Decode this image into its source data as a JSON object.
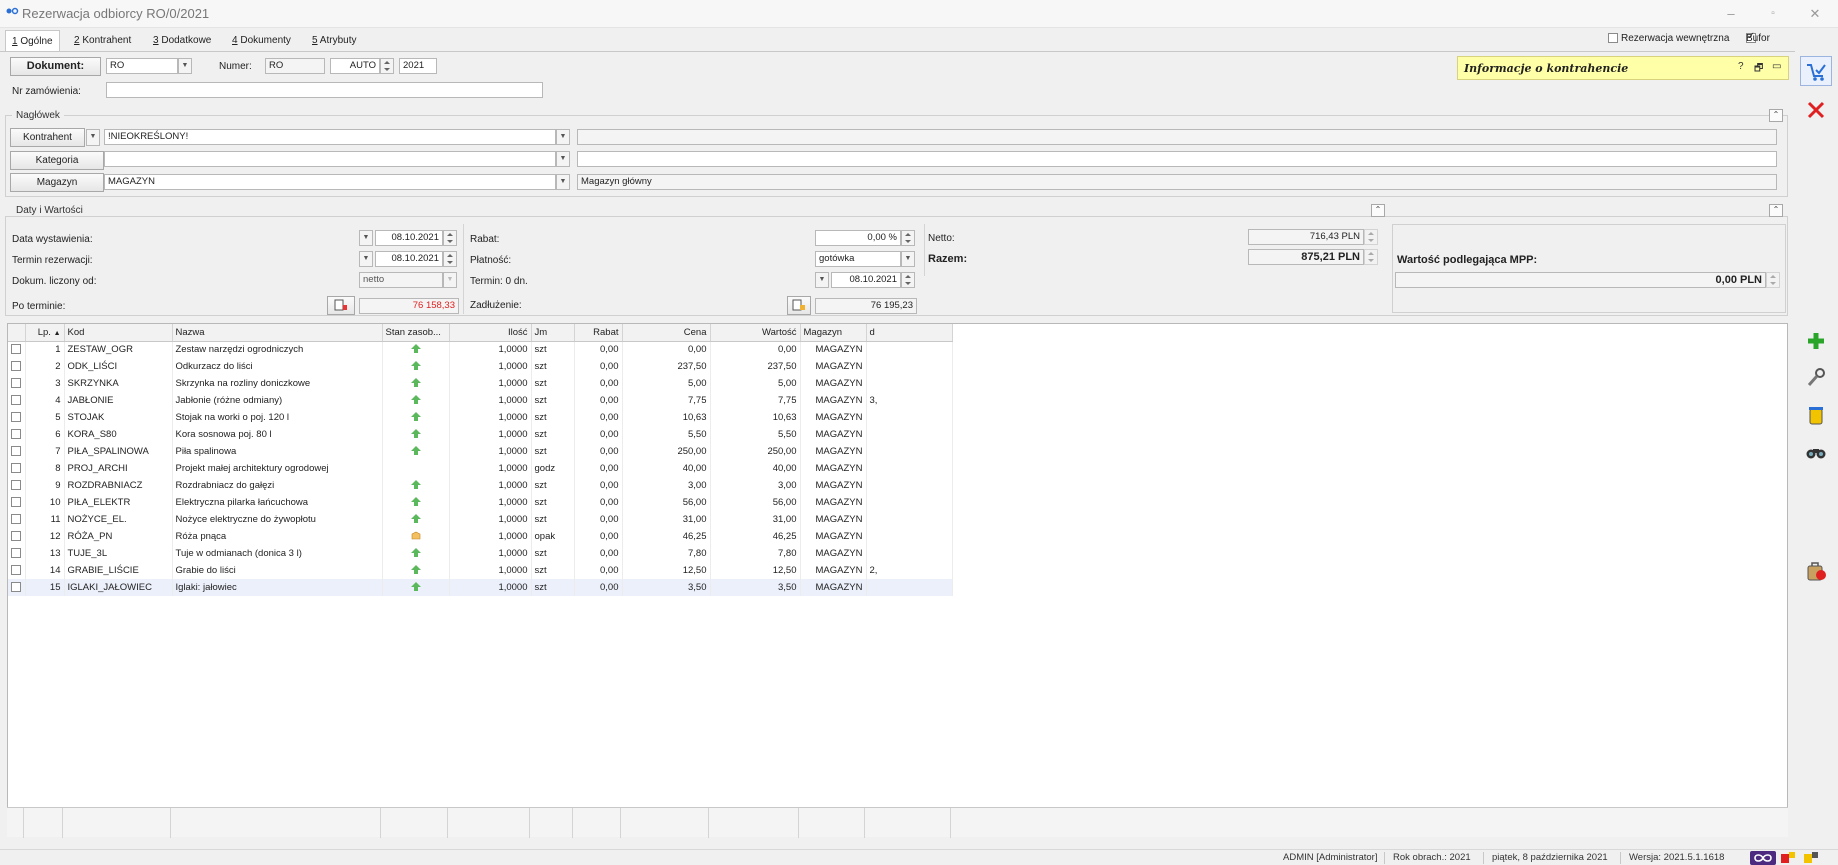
{
  "window": {
    "title": "Rezerwacja odbiorcy RO/0/2021"
  },
  "tabs": [
    {
      "key": "1",
      "label": " Ogólne"
    },
    {
      "key": "2",
      "label": " Kontrahent"
    },
    {
      "key": "3",
      "label": " Dodatkowe"
    },
    {
      "key": "4",
      "label": " Dokumenty"
    },
    {
      "key": "5",
      "label": " Atrybuty"
    }
  ],
  "top_options": {
    "internal_label": "Rezerwacja wewnętrzna",
    "buffer_label": "Bufor"
  },
  "document": {
    "doc_label": "Dokument:",
    "doc_value": "RO",
    "number_label": "Numer:",
    "number_prefix": "RO",
    "number_auto": "AUTO",
    "number_year": "2021",
    "order_label": "Nr zamówienia:",
    "order_value": ""
  },
  "info": {
    "title": "Informacje o kontrahencie",
    "help": "?"
  },
  "header": {
    "title": "Nagłówek",
    "kontrahent_btn": "Kontrahent",
    "kontrahent_value": "!NIEOKREŚLONY!",
    "kontrahent_desc": "",
    "kategoria_btn": "Kategoria",
    "kategoria_value": "",
    "kategoria_desc": "",
    "magazyn_btn": "Magazyn",
    "magazyn_value": "MAGAZYN",
    "magazyn_desc": "Magazyn główny"
  },
  "dates": {
    "title": "Daty i Wartości",
    "issue_label": "Data wystawienia:",
    "issue_value": "08.10.2021",
    "reserve_label": "Termin rezerwacji:",
    "reserve_value": "08.10.2021",
    "calc_label": "Dokum. liczony od:",
    "calc_value": "netto",
    "overdue_label": "Po terminie:",
    "overdue_value": "76 158,33",
    "discount_label": "Rabat:",
    "discount_value": "0,00 %",
    "payment_label": "Płatność:",
    "payment_value": "gotówka",
    "term_label": "Termin: 0 dn.",
    "term_value": "08.10.2021",
    "debt_label": "Zadłużenie:",
    "debt_value": "76 195,23",
    "net_label": "Netto:",
    "net_value": "716,43 PLN",
    "total_label": "Razem:",
    "total_value": "875,21 PLN",
    "mpp_label": "Wartość podlegająca MPP:",
    "mpp_value": "0,00 PLN"
  },
  "table": {
    "headers": [
      "",
      "Lp.",
      "Kod",
      "Nazwa",
      "Stan zasob...",
      "Ilość",
      "Jm",
      "Rabat",
      "Cena",
      "Wartość",
      "Magazyn",
      "d"
    ],
    "sort_icon": "▲",
    "rows": [
      [
        "1",
        "ZESTAW_OGR",
        "Zestaw narzędzi ogrodniczych",
        "up",
        "1,0000",
        "szt",
        "0,00",
        "0,00",
        "0,00",
        "MAGAZYN",
        ""
      ],
      [
        "2",
        "ODK_LIŚCI",
        "Odkurzacz do liści",
        "up",
        "1,0000",
        "szt",
        "0,00",
        "237,50",
        "237,50",
        "MAGAZYN",
        ""
      ],
      [
        "3",
        "SKRZYNKA",
        "Skrzynka na rozliny doniczkowe",
        "up",
        "1,0000",
        "szt",
        "0,00",
        "5,00",
        "5,00",
        "MAGAZYN",
        ""
      ],
      [
        "4",
        "JABŁONIE",
        "Jabłonie (różne odmiany)",
        "up",
        "1,0000",
        "szt",
        "0,00",
        "7,75",
        "7,75",
        "MAGAZYN",
        "3,"
      ],
      [
        "5",
        "STOJAK",
        "Stojak na worki o poj. 120 l",
        "up",
        "1,0000",
        "szt",
        "0,00",
        "10,63",
        "10,63",
        "MAGAZYN",
        ""
      ],
      [
        "6",
        "KORA_S80",
        "Kora sosnowa poj. 80 l",
        "up",
        "1,0000",
        "szt",
        "0,00",
        "5,50",
        "5,50",
        "MAGAZYN",
        ""
      ],
      [
        "7",
        "PIŁA_SPALINOWA",
        "Piła spalinowa",
        "up",
        "1,0000",
        "szt",
        "0,00",
        "250,00",
        "250,00",
        "MAGAZYN",
        ""
      ],
      [
        "8",
        "PROJ_ARCHI",
        "Projekt małej architektury ogrodowej",
        "",
        "1,0000",
        "godz",
        "0,00",
        "40,00",
        "40,00",
        "MAGAZYN",
        ""
      ],
      [
        "9",
        "ROZDRABNIACZ",
        "Rozdrabniacz do gałęzi",
        "up",
        "1,0000",
        "szt",
        "0,00",
        "3,00",
        "3,00",
        "MAGAZYN",
        ""
      ],
      [
        "10",
        "PIŁA_ELEKTR",
        "Elektryczna pilarka łańcuchowa",
        "up",
        "1,0000",
        "szt",
        "0,00",
        "56,00",
        "56,00",
        "MAGAZYN",
        ""
      ],
      [
        "11",
        "NOŻYCE_EL.",
        "Nożyce elektryczne do żywopłotu",
        "up",
        "1,0000",
        "szt",
        "0,00",
        "31,00",
        "31,00",
        "MAGAZYN",
        ""
      ],
      [
        "12",
        "RÓŻA_PN",
        "Róża pnąca",
        "box",
        "1,0000",
        "opak",
        "0,00",
        "46,25",
        "46,25",
        "MAGAZYN",
        ""
      ],
      [
        "13",
        "TUJE_3L",
        "Tuje w odmianach (donica 3 l)",
        "up",
        "1,0000",
        "szt",
        "0,00",
        "7,80",
        "7,80",
        "MAGAZYN",
        ""
      ],
      [
        "14",
        "GRABIE_LIŚCIE",
        "Grabie do liści",
        "up",
        "1,0000",
        "szt",
        "0,00",
        "12,50",
        "12,50",
        "MAGAZYN",
        "2,"
      ],
      [
        "15",
        "IGLAKI_JAŁOWIEC",
        "Iglaki: jałowiec",
        "up",
        "1,0000",
        "szt",
        "0,00",
        "3,50",
        "3,50",
        "MAGAZYN",
        ""
      ]
    ]
  },
  "status": {
    "user": "ADMIN [Administrator]",
    "year": "Rok obrach.: 2021",
    "date": "piątek, 8 października 2021",
    "version": "Wersja: 2021.5.1.1618"
  },
  "colors": {
    "accent": "#2a6fd6",
    "overdue": "#e02020",
    "info_bg": "#ffffa8"
  }
}
